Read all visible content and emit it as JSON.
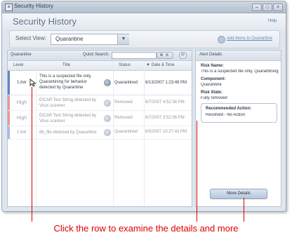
{
  "window": {
    "title": "Security History",
    "controls": [
      "minimize",
      "maximize",
      "close"
    ]
  },
  "header": {
    "page_title": "Security History",
    "help": "Help"
  },
  "view_bar": {
    "select_label": "Select View:",
    "selected_view": "Quarantine",
    "add_link": "Add Items to Quarantine"
  },
  "list_panel": {
    "title": "Quarantine",
    "quick_search_label": "Quick Search:",
    "quick_search_value": "",
    "columns": {
      "level": "Level",
      "title": "Title",
      "status": "Status",
      "date": "▼ Date & Time"
    },
    "rows": [
      {
        "level": "Low",
        "title": "This is a suspected file only, Quarantining for behavior detected by Quarantine",
        "status": "Quarantined",
        "date": "6/13/2007 1:23:49 PM",
        "color": "#5b87c7",
        "selected": true
      },
      {
        "level": "High",
        "title": "EICAR Test String detected by Virus scanner",
        "status": "Removed",
        "date": "6/7/2007 4:52:36 PM",
        "color": "#d54545",
        "selected": false
      },
      {
        "level": "High",
        "title": "EICAR Test String detected by Virus scanner",
        "status": "Removed",
        "date": "6/7/2007 3:52:36 PM",
        "color": "#d54545",
        "selected": false
      },
      {
        "level": "Low",
        "title": "db_file detected by Quarantine",
        "status": "Quarantined",
        "date": "6/5/2007 10:27:43 PM",
        "color": "#5b87c7",
        "selected": false
      }
    ]
  },
  "details_panel": {
    "title": "Alert Details",
    "risk_name_label": "Risk Name:",
    "risk_name": "This is a suspected file only, Quarantining for b",
    "component_label": "Component:",
    "component": "Quarantine",
    "risk_state_label": "Risk State:",
    "risk_state": "Fully removed",
    "recommended_label": "Recommended Action:",
    "recommended": "Resolved - No Action",
    "more_button": "More Details"
  },
  "annotation": {
    "caption": "Click the row to examine the details and more",
    "color": "#e20000"
  }
}
